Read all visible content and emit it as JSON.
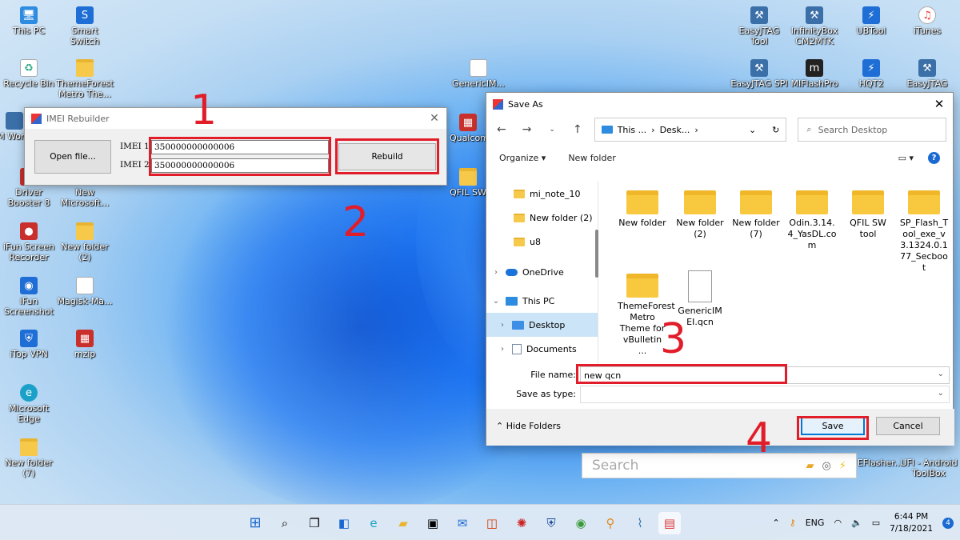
{
  "desktop": {
    "icons_left": [
      {
        "label": "This PC"
      },
      {
        "label": "Smart Switch"
      },
      {
        "label": "Recycle Bin"
      },
      {
        "label": "ThemeForest Metro The..."
      },
      {
        "label": "VM Work..."
      },
      {
        "label": "Driver Booster 8"
      },
      {
        "label": "New Microsoft..."
      },
      {
        "label": "iFun Screen Recorder"
      },
      {
        "label": "New folder (2)"
      },
      {
        "label": "iFun Screenshot"
      },
      {
        "label": "Magisk-Ma..."
      },
      {
        "label": "iTop VPN"
      },
      {
        "label": "mzip"
      },
      {
        "label": "Microsoft Edge"
      },
      {
        "label": "New folder (7)"
      }
    ],
    "icons_middle": [
      {
        "label": "GenericIM..."
      },
      {
        "label": "Qualcom..."
      },
      {
        "label": "QFIL SW"
      }
    ],
    "icons_right": [
      {
        "label": "EasyJTAG Tool"
      },
      {
        "label": "InfinityBox CM2MTK"
      },
      {
        "label": "UBTool"
      },
      {
        "label": "iTunes"
      },
      {
        "label": "EasyJTAG SPI"
      },
      {
        "label": "MIFlashPro"
      },
      {
        "label": "HQT2"
      },
      {
        "label": "EasyJTAG"
      },
      {
        "label": "EFlasher..."
      },
      {
        "label": "UFI - Android ToolBox"
      }
    ]
  },
  "imei_window": {
    "title": "IMEI Rebuilder",
    "open_file_label": "Open file...",
    "imei1_label": "IMEI 1:",
    "imei1_value": "350000000000006",
    "imei2_label": "IMEI 2:",
    "imei2_value": "350000000000006",
    "rebuild_label": "Rebuild"
  },
  "annotations": {
    "step1": "1",
    "step2": "2",
    "step3": "3",
    "step4": "4",
    "color": "#e11d2a"
  },
  "save_dialog": {
    "title": "Save As",
    "breadcrumb": [
      "This ...",
      "Desk..."
    ],
    "search_placeholder": "Search Desktop",
    "organize_label": "Organize",
    "new_folder_label": "New folder",
    "nav_items": [
      {
        "label": "mi_note_10"
      },
      {
        "label": "New folder (2)"
      },
      {
        "label": "u8"
      },
      {
        "label": "OneDrive"
      },
      {
        "label": "This PC"
      },
      {
        "label": "Desktop"
      },
      {
        "label": "Documents"
      }
    ],
    "files": [
      {
        "name": "New folder",
        "type": "folder"
      },
      {
        "name": "New folder (2)",
        "type": "folder"
      },
      {
        "name": "New folder (7)",
        "type": "folder"
      },
      {
        "name": "Odin.3.14.4_YasDL.com",
        "type": "folder"
      },
      {
        "name": "QFIL SW tool",
        "type": "folder"
      },
      {
        "name": "SP_Flash_Tool_exe_v3.1324.0.177_Secboot",
        "type": "folder"
      },
      {
        "name": "ThemeForest Metro Theme for vBulletin ...",
        "type": "folder"
      },
      {
        "name": "GenericIMEI.qcn",
        "type": "file"
      }
    ],
    "file_name_label": "File name:",
    "file_name_value": "new qcn",
    "save_as_type_label": "Save as type:",
    "save_as_type_value": "",
    "hide_folders_label": "Hide Folders",
    "save_label": "Save",
    "cancel_label": "Cancel"
  },
  "search_popup": {
    "placeholder": "Search"
  },
  "taskbar": {
    "language": "ENG",
    "time": "6:44 PM",
    "date": "7/18/2021",
    "notifications": "4"
  }
}
